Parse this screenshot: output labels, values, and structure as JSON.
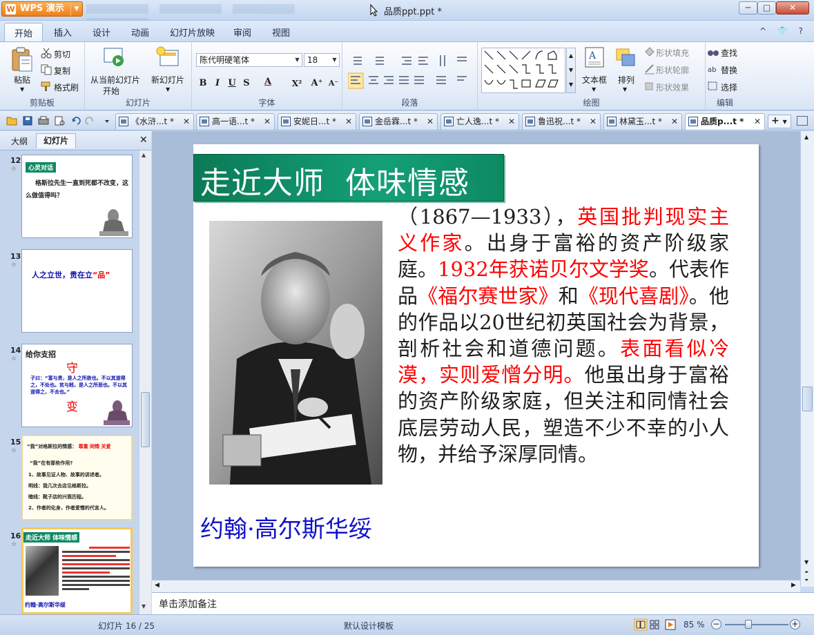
{
  "app": {
    "menu_button": "WPS 演示",
    "doc_title": "品质ppt.ppt *"
  },
  "window_controls": {
    "minimize": "─",
    "maximize": "□",
    "close": "✕"
  },
  "menu_tabs": [
    "开始",
    "插入",
    "设计",
    "动画",
    "幻灯片放映",
    "审阅",
    "视图"
  ],
  "menu_right": "^ 👕 ?",
  "ribbon": {
    "clipboard": {
      "label": "剪贴板",
      "paste": "粘贴",
      "cut": "剪切",
      "copy": "复制",
      "format_painter": "格式刷"
    },
    "slides": {
      "label": "幻灯片",
      "from_current": "从当前幻灯片",
      "from_current_2": "开始",
      "new_slide": "新幻灯片"
    },
    "font": {
      "label": "字体",
      "font_name": "陈代明硬笔体",
      "font_size": "18",
      "bold": "B",
      "italic": "I",
      "underline": "U",
      "strike": "S",
      "color": "A",
      "super": "X²",
      "grow": "A⁺",
      "shrink": "A⁻"
    },
    "paragraph": {
      "label": "段落"
    },
    "drawing": {
      "label": "绘图",
      "textbox": "文本框",
      "arrange": "排列",
      "shape_fill": "形状填充",
      "shape_outline": "形状轮廓",
      "shape_effect": "形状效果"
    },
    "editing": {
      "label": "编辑",
      "find": "查找",
      "replace": "替换",
      "select": "选择"
    }
  },
  "doc_tabs": [
    {
      "label": "《水浒...t *",
      "active": false
    },
    {
      "label": "高一语...t *",
      "active": false
    },
    {
      "label": "安妮日...t *",
      "active": false
    },
    {
      "label": "金岳霖...t *",
      "active": false
    },
    {
      "label": "亡人逸...t *",
      "active": false
    },
    {
      "label": "鲁迅祝...t *",
      "active": false
    },
    {
      "label": "林黛玉...t *",
      "active": false
    },
    {
      "label": "品质p...t *",
      "active": true
    }
  ],
  "left_panel": {
    "tab_outline": "大纲",
    "tab_slides": "幻灯片",
    "close": "✕",
    "thumbs": [
      {
        "num": "12",
        "title": "心灵对话",
        "text": "格斯拉先生一直到死都不改变，这么做值得吗？"
      },
      {
        "num": "13",
        "text_a": "人之立世，贵在立",
        "text_b": "“品”"
      },
      {
        "num": "14",
        "title": "给你支招",
        "big1": "守",
        "quote": "子曰：“富与贵，是人之所欲也。不以其道得之，不处也。贫与贱，是人之所恶也。不以其道得之，不去也。”",
        "big2": "变"
      },
      {
        "num": "15",
        "line1a": "“我”对格斯拉的情感：",
        "line1b": "尊重  同情  关爱",
        "line2": "“我”在有那些作用?",
        "line3": "1、故事见证人物、故事的讲述者。",
        "line4": "明线：我几次去店见格斯拉。",
        "line5": "暗线：靴子店的兴衰历程。",
        "line6": "2、作者的化身，作者爱憎的代言人。"
      },
      {
        "num": "16",
        "title": "走近大师  体味情感",
        "footer": "约翰·高尔斯华绥"
      }
    ]
  },
  "slide": {
    "title": "走近大师  体味情感",
    "name": "约翰·高尔斯华绥",
    "body_segments": [
      {
        "text": "（1867—1933），",
        "color": "#000000"
      },
      {
        "text": "英国批判现实主义作家",
        "color": "#ff0000"
      },
      {
        "text": "。出身于富裕的资产阶级家庭。",
        "color": "#000000"
      },
      {
        "text": "1932年获诺贝尔文学奖",
        "color": "#ff0000"
      },
      {
        "text": "。代表作品",
        "color": "#000000"
      },
      {
        "text": "《福尔赛世家》",
        "color": "#ff0000"
      },
      {
        "text": "和",
        "color": "#000000"
      },
      {
        "text": "《现代喜剧》",
        "color": "#ff0000"
      },
      {
        "text": "。他的作品以20世纪初英国社会为背景，剖析社会和道德问题。",
        "color": "#000000"
      },
      {
        "text": "表面看似冷漠，实则爱憎分明。",
        "color": "#ff0000"
      },
      {
        "text": "他虽出身于富裕的资产阶级家庭，但关注和同情社会底层劳动人民，塑造不少不幸的小人物，并给予深厚同情。",
        "color": "#000000"
      }
    ]
  },
  "notes_placeholder": "单击添加备注",
  "status": {
    "slide_counter": "幻灯片 16 / 25",
    "template": "默认设计模板",
    "zoom": "85 %"
  },
  "colors": {
    "title_band": "#0e8a62",
    "name_blue": "#1010c8",
    "red": "#ff0000"
  }
}
